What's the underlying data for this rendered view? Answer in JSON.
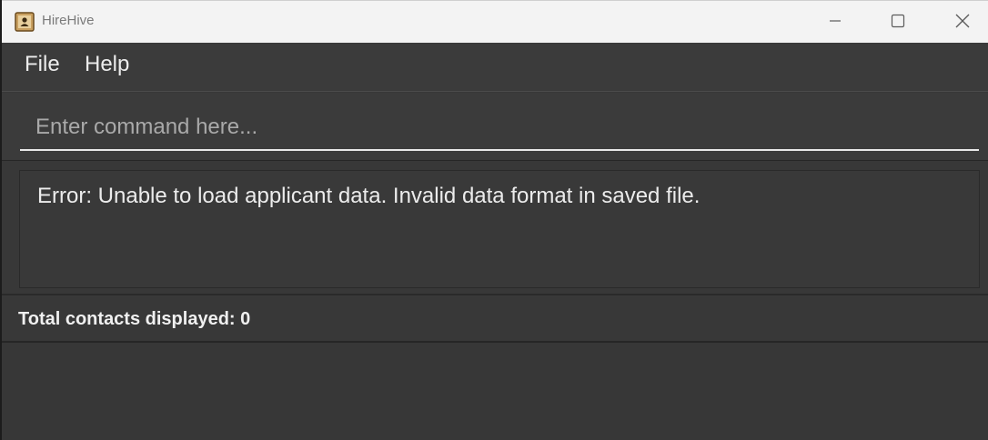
{
  "window": {
    "title": "HireHive",
    "app_icon": "contacts-book-icon",
    "controls": {
      "minimize_icon": "minimize-icon",
      "maximize_icon": "maximize-icon",
      "close_icon": "close-icon"
    }
  },
  "menu": {
    "items": [
      {
        "label": "File"
      },
      {
        "label": "Help"
      }
    ]
  },
  "command": {
    "value": "",
    "placeholder": "Enter command here..."
  },
  "result": {
    "message": "Error: Unable to load applicant data. Invalid data format in saved file."
  },
  "status": {
    "text": "Total contacts displayed: 0"
  },
  "colors": {
    "background": "#383838",
    "titlebar": "#f3f3f3",
    "text": "#ececec"
  }
}
